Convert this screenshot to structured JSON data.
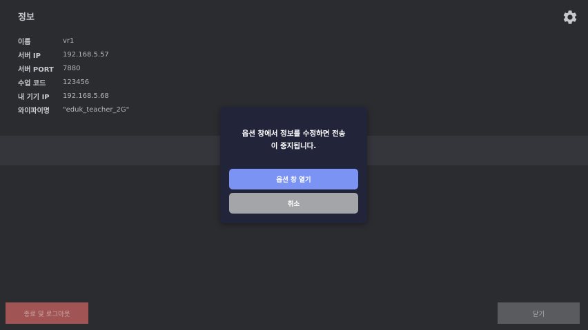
{
  "page": {
    "title": "정보",
    "settings_icon": "gear-icon"
  },
  "info": [
    {
      "key": "이름",
      "value": "vr1"
    },
    {
      "key": "서버 IP",
      "value": "192.168.5.57"
    },
    {
      "key": "서버 PORT",
      "value": "7880"
    },
    {
      "key": "수업 코드",
      "value": "123456"
    },
    {
      "key": "내 기기 IP",
      "value": "192.168.5.68"
    },
    {
      "key": "와이파이명",
      "value": "\"eduk_teacher_2G\""
    }
  ],
  "dialog": {
    "message_line1": "옵션 창에서 정보를 수정하면 전송",
    "message_line2": "이 중지됩니다.",
    "open_label": "옵션 창 열기",
    "cancel_label": "취소"
  },
  "footer": {
    "logout_label": "종료 및 로그아웃",
    "close_label": "닫기"
  },
  "colors": {
    "background": "#2b2c30",
    "dialog": "#22253a",
    "primary": "#7b93f3",
    "cancel": "#a4a5a9",
    "logout": "#a05554",
    "close": "#5a5b5f"
  }
}
